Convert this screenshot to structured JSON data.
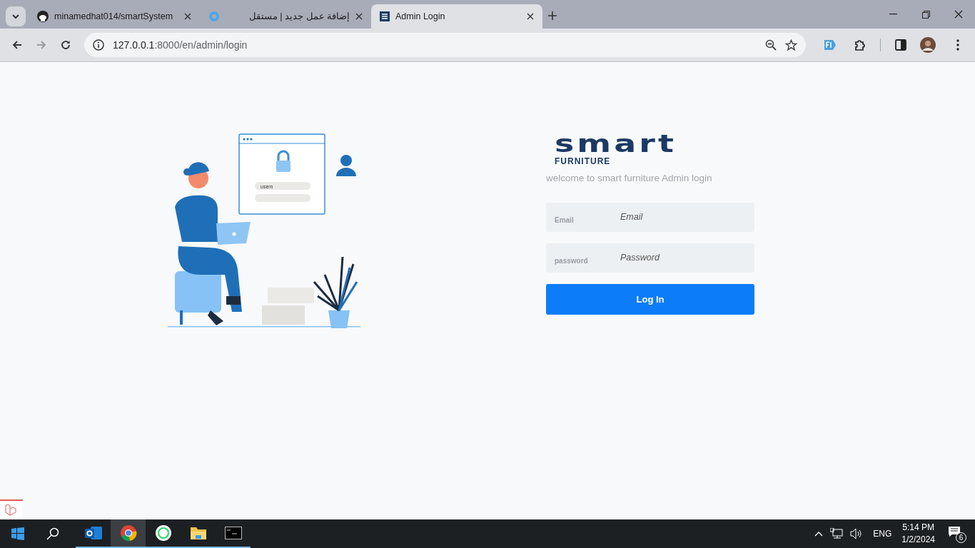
{
  "browser": {
    "tabs": [
      {
        "label": "minamedhat014/smartSystem",
        "kind": "github",
        "selected": false
      },
      {
        "label": "إضافة عمل جديد | مستقل",
        "kind": "ring",
        "selected": false
      },
      {
        "label": "Admin Login",
        "kind": "s",
        "selected": true
      }
    ],
    "address": {
      "host": "127.0.0.1",
      "rest": ":8000/en/admin/login"
    }
  },
  "illustration": {
    "field_text": "usern"
  },
  "logo": {
    "word": "smart",
    "sub": "FURNITURE"
  },
  "welcome": "welcome to smart furniture Admin login",
  "fields": [
    {
      "label": "Email",
      "placeholder": "Email"
    },
    {
      "label": "password",
      "placeholder": "Password"
    }
  ],
  "submit": "Log In",
  "taskbar": {
    "apps": [
      {
        "kind": "outlook",
        "selected": false
      },
      {
        "kind": "chrome",
        "selected": true
      },
      {
        "kind": "whatsapp",
        "selected": false
      },
      {
        "kind": "explorer",
        "selected": false
      },
      {
        "kind": "terminal",
        "selected": false
      }
    ],
    "language": "ENG",
    "time": "5:14 PM",
    "date": "1/2/2024",
    "notifications": "6"
  }
}
